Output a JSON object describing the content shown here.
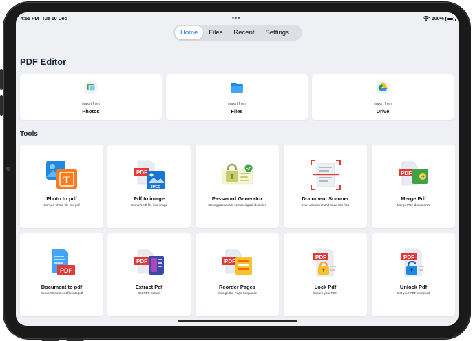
{
  "status_bar": {
    "time": "4:55 PM",
    "date": "Tue 10 Dec",
    "dots": "•••",
    "battery_percent": "100%",
    "battery_level": 1.0
  },
  "tabs": [
    {
      "label": "Home",
      "active": true
    },
    {
      "label": "Files",
      "active": false
    },
    {
      "label": "Recent",
      "active": false
    },
    {
      "label": "Settings",
      "active": false
    }
  ],
  "page_title": "PDF Editor",
  "import_prefix": "import from",
  "imports": [
    {
      "label": "Photos",
      "icon": "photos-icon"
    },
    {
      "label": "Files",
      "icon": "folder-icon"
    },
    {
      "label": "Drive",
      "icon": "google-drive-icon"
    }
  ],
  "tools_title": "Tools",
  "tools": [
    {
      "name": "Photo to pdf",
      "desc": "Convert photo file into pdf",
      "icon": "photo-to-pdf-icon"
    },
    {
      "name": "Pdf to image",
      "desc": "Convert pdf file into image",
      "icon": "pdf-to-image-icon"
    },
    {
      "name": "Password Generator",
      "desc": "Strong passwords secure digital identities",
      "icon": "password-generator-icon"
    },
    {
      "name": "Document Scanner",
      "desc": "Scan document and save into files",
      "icon": "document-scanner-icon"
    },
    {
      "name": "Merge Pdf",
      "desc": "Merge PDF documents",
      "icon": "merge-pdf-icon"
    },
    {
      "name": "Document to pdf",
      "desc": "Convert Document file into pdf",
      "icon": "document-to-pdf-icon"
    },
    {
      "name": "Extract Pdf",
      "desc": "Get PDF Extract",
      "icon": "extract-pdf-icon"
    },
    {
      "name": "Reorder Pages",
      "desc": "Change the Page Sequance",
      "icon": "reorder-pages-icon"
    },
    {
      "name": "Lock Pdf",
      "desc": "Secure your PDF",
      "icon": "lock-pdf-icon"
    },
    {
      "name": "Unlock Pdf",
      "desc": "Get your PDF unlocked",
      "icon": "unlock-pdf-icon"
    }
  ],
  "icon_text": {
    "pdf": "PDF",
    "jpeg": "JPEG",
    "t": "T"
  },
  "colors": {
    "accent": "#1478f0",
    "pdf_red": "#e53935",
    "background": "#eef0f3"
  }
}
